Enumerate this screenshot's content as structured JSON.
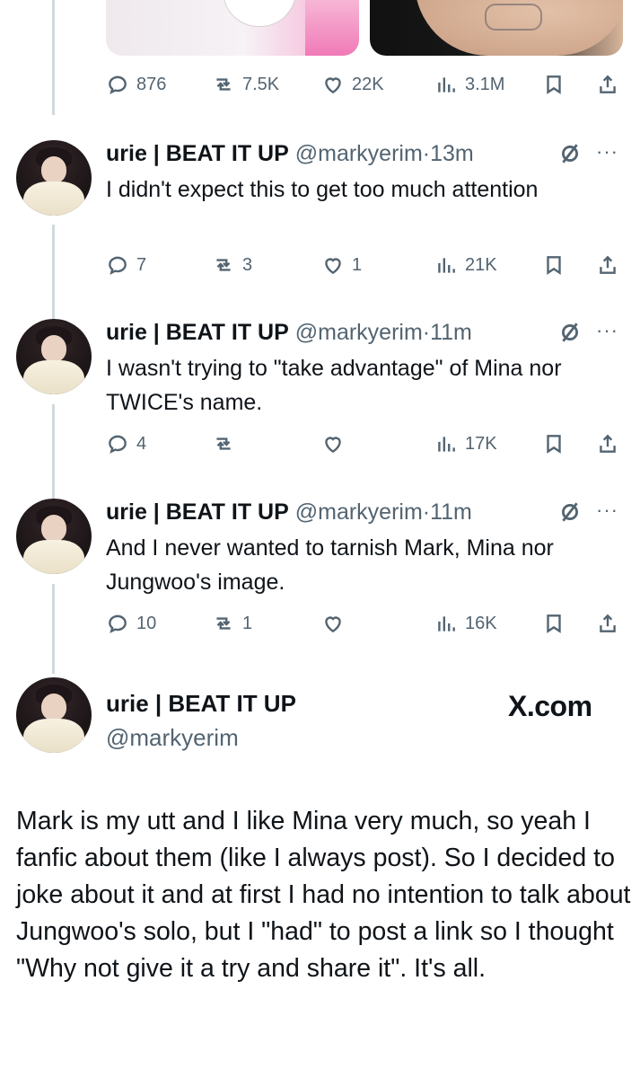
{
  "top_actions": {
    "reply_count": "876",
    "retweet_count": "7.5K",
    "like_count": "22K",
    "view_count": "3.1M"
  },
  "tweets": [
    {
      "name": "urie | BEAT IT UP",
      "handle": "@markyerim",
      "dot": "·",
      "time": "13m",
      "text": "I didn't expect this to get too much attention",
      "reply_count": "7",
      "retweet_count": "3",
      "like_count": "1",
      "view_count": "21K"
    },
    {
      "name": "urie | BEAT IT UP",
      "handle": "@markyerim",
      "dot": "·",
      "time": "11m",
      "text": "I wasn't trying to \"take advantage\" of Mina nor TWICE's name.",
      "reply_count": "4",
      "retweet_count": "",
      "like_count": "",
      "view_count": "17K"
    },
    {
      "name": "urie | BEAT IT UP",
      "handle": "@markyerim",
      "dot": "·",
      "time": "11m",
      "text": "And I never wanted to tarnish Mark, Mina nor Jungwoo's image.",
      "reply_count": "10",
      "retweet_count": "1",
      "like_count": "",
      "view_count": "16K"
    }
  ],
  "profile": {
    "name": "urie | BEAT IT UP",
    "handle": "@markyerim",
    "site": "X.com"
  },
  "statement": "Mark is my utt and I like Mina very much, so yeah I fanfic about them (like I always post). So I decided to joke about it and at first I had no intention to talk about Jungwoo's solo, but I \"had\" to post a link so I thought \"Why not give it a try and share it\". It's all.",
  "icons": {
    "reply": "reply-icon",
    "retweet": "retweet-icon",
    "like": "heart-icon",
    "views": "views-icon",
    "bookmark": "bookmark-icon",
    "share": "share-icon",
    "grok": "grok-icon",
    "more": "more-icon"
  },
  "colors": {
    "text": "#0f1419",
    "secondary": "#536471",
    "thread_line": "#cfd9de"
  }
}
